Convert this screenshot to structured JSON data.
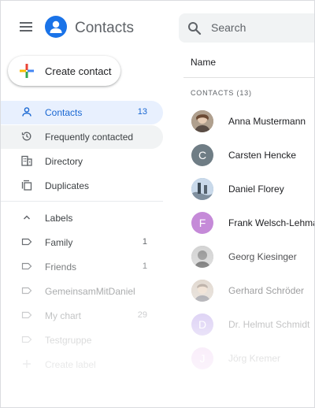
{
  "header": {
    "app_title": "Contacts",
    "search_placeholder": "Search"
  },
  "create_button": {
    "label": "Create contact"
  },
  "sidebar": {
    "items": [
      {
        "label": "Contacts",
        "count": "13"
      },
      {
        "label": "Frequently contacted",
        "count": ""
      },
      {
        "label": "Directory",
        "count": ""
      },
      {
        "label": "Duplicates",
        "count": ""
      }
    ],
    "labels_header": "Labels",
    "labels": [
      {
        "label": "Family",
        "count": "1"
      },
      {
        "label": "Friends",
        "count": "1"
      },
      {
        "label": "GemeinsamMitDaniel",
        "count": ""
      },
      {
        "label": "My chart",
        "count": "29"
      },
      {
        "label": "Testgruppe",
        "count": ""
      }
    ],
    "create_label": "Create label"
  },
  "main": {
    "column_header": "Name",
    "section_title": "CONTACTS (13)",
    "contacts": [
      {
        "name": "Anna Mustermann",
        "initial": "",
        "color": "#8d7b6a"
      },
      {
        "name": "Carsten Hencke",
        "initial": "C",
        "color": "#6f7d85"
      },
      {
        "name": "Daniel Florey",
        "initial": "",
        "color": "#7aa0c6"
      },
      {
        "name": "Frank Welsch-Lehmann",
        "initial": "F",
        "color": "#c58ad8"
      },
      {
        "name": "Georg Kiesinger",
        "initial": "",
        "color": "#9e9e9e"
      },
      {
        "name": "Gerhard Schröder",
        "initial": "",
        "color": "#a08470"
      },
      {
        "name": "Dr. Helmut Schmidt",
        "initial": "D",
        "color": "#9c7be0"
      },
      {
        "name": "Jörg Kremer",
        "initial": "J",
        "color": "#d98fe0"
      }
    ]
  },
  "colors": {
    "accent": "#1a73e8",
    "active_bg": "#e8f0fe",
    "active_text": "#1967d2"
  }
}
